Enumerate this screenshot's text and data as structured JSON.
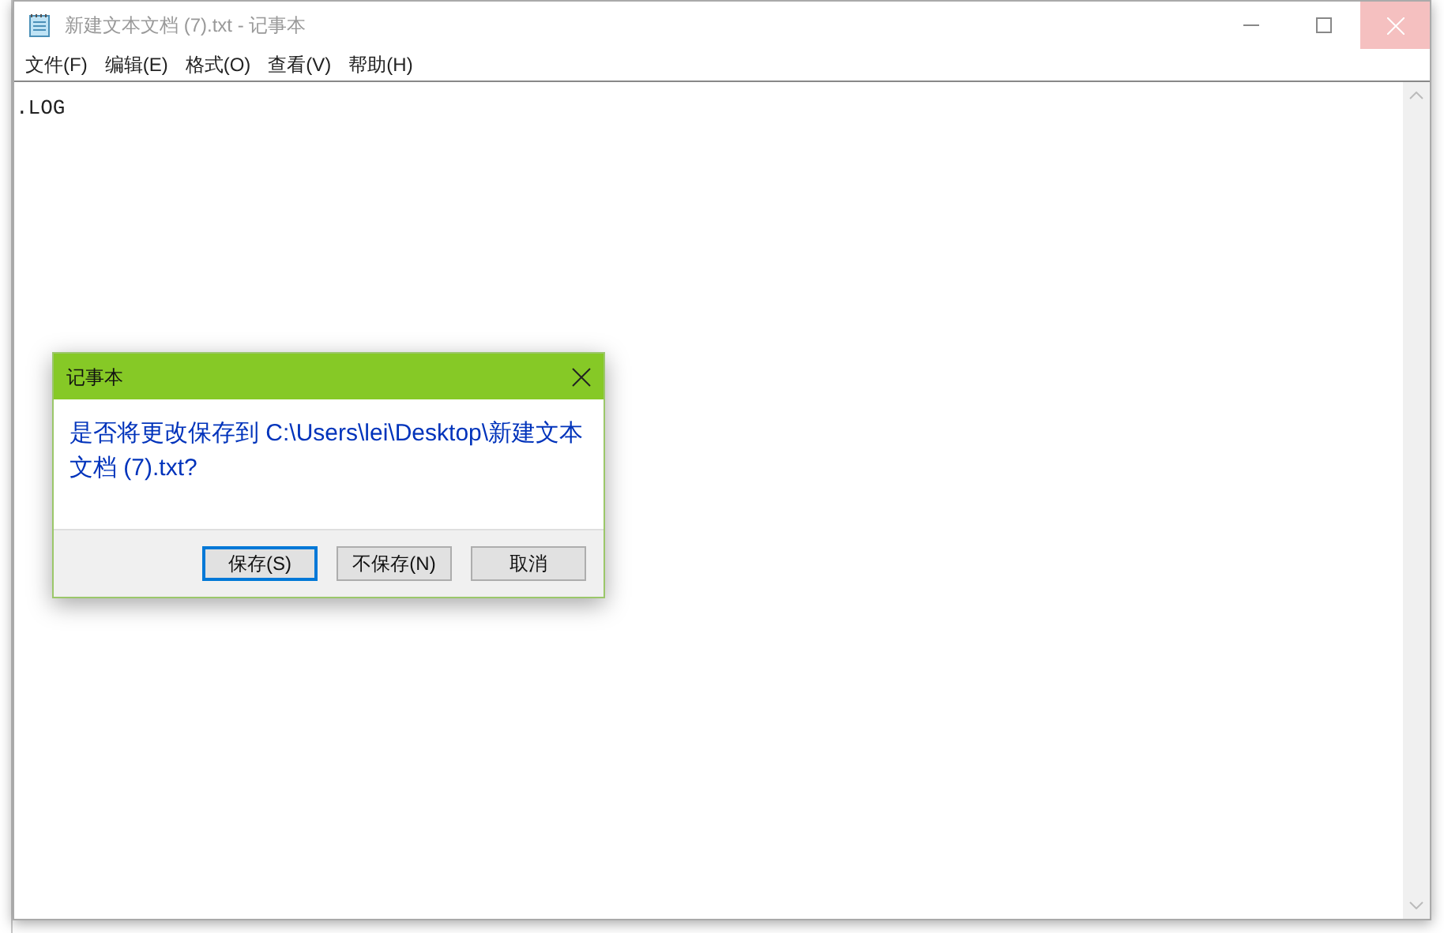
{
  "window": {
    "title": "新建文本文档 (7).txt - 记事本"
  },
  "menu": [
    "文件(F)",
    "编辑(E)",
    "格式(O)",
    "查看(V)",
    "帮助(H)"
  ],
  "editor": {
    "text": ".LOG"
  },
  "dialog": {
    "title": "记事本",
    "message": "是否将更改保存到 C:\\Users\\lei\\Desktop\\新建文本文档 (7).txt?",
    "buttons": [
      {
        "label": "保存(S)",
        "focused": true
      },
      {
        "label": "不保存(N)",
        "focused": false
      },
      {
        "label": "取消",
        "focused": false
      }
    ]
  }
}
